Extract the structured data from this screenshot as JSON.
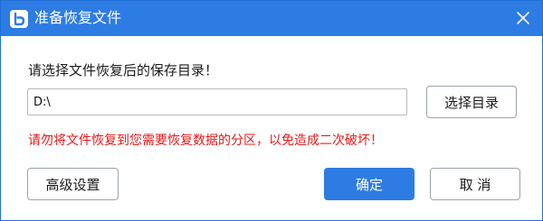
{
  "window": {
    "title": "准备恢复文件",
    "icon": "app-logo-icon",
    "accent_color": "#2d7ce3"
  },
  "prompt": "请选择文件恢复后的保存目录！",
  "path_input": {
    "value": "D:\\"
  },
  "buttons": {
    "select_dir": "选择目录",
    "advanced": "高级设置",
    "ok": "确定",
    "cancel": "取 消"
  },
  "warning": {
    "text": "请勿将文件恢复到您需要恢复数据的分区，以免造成二次破坏！",
    "color": "#e81818"
  }
}
